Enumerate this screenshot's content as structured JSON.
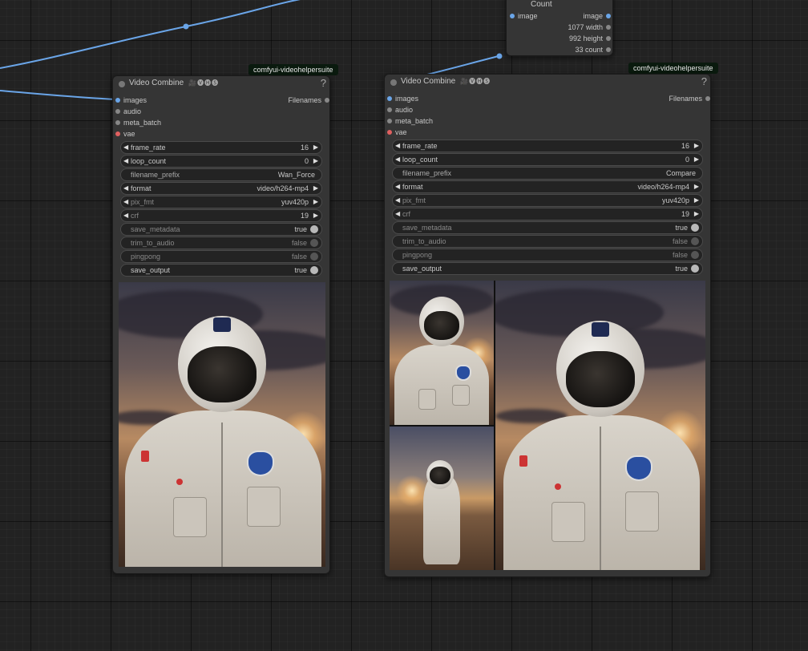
{
  "top_node": {
    "title": "Get Image Size & Count",
    "input_label": "image",
    "outputs": [
      {
        "label": "image"
      },
      {
        "label": "1077 width"
      },
      {
        "label": "992 height"
      },
      {
        "label": "33 count"
      }
    ]
  },
  "node1": {
    "badge": "comfyui-videohelpersuite",
    "title": "Video Combine",
    "title_icons": "🎥🅥🅗🅢",
    "help": "?",
    "inputs": [
      "images",
      "audio",
      "meta_batch",
      "vae"
    ],
    "output": "Filenames",
    "widgets": {
      "frame_rate": {
        "label": "frame_rate",
        "value": "16"
      },
      "loop_count": {
        "label": "loop_count",
        "value": "0"
      },
      "filename_prefix": {
        "label": "filename_prefix",
        "value": "Wan_Force"
      },
      "format": {
        "label": "format",
        "value": "video/h264-mp4"
      },
      "pix_fmt": {
        "label": "pix_fmt",
        "value": "yuv420p"
      },
      "crf": {
        "label": "crf",
        "value": "19"
      },
      "save_metadata": {
        "label": "save_metadata",
        "value": "true"
      },
      "trim_to_audio": {
        "label": "trim_to_audio",
        "value": "false"
      },
      "pingpong": {
        "label": "pingpong",
        "value": "false"
      },
      "save_output": {
        "label": "save_output",
        "value": "true"
      }
    }
  },
  "node2": {
    "badge": "comfyui-videohelpersuite",
    "title": "Video Combine",
    "title_icons": "🎥🅥🅗🅢",
    "help": "?",
    "inputs": [
      "images",
      "audio",
      "meta_batch",
      "vae"
    ],
    "output": "Filenames",
    "widgets": {
      "frame_rate": {
        "label": "frame_rate",
        "value": "16"
      },
      "loop_count": {
        "label": "loop_count",
        "value": "0"
      },
      "filename_prefix": {
        "label": "filename_prefix",
        "value": "Compare"
      },
      "format": {
        "label": "format",
        "value": "video/h264-mp4"
      },
      "pix_fmt": {
        "label": "pix_fmt",
        "value": "yuv420p"
      },
      "crf": {
        "label": "crf",
        "value": "19"
      },
      "save_metadata": {
        "label": "save_metadata",
        "value": "true"
      },
      "trim_to_audio": {
        "label": "trim_to_audio",
        "value": "false"
      },
      "pingpong": {
        "label": "pingpong",
        "value": "false"
      },
      "save_output": {
        "label": "save_output",
        "value": "true"
      }
    }
  },
  "colors": {
    "canvas": "#222222",
    "node_bg": "#353535",
    "link_blue": "#6aa5e8",
    "badge_bg": "#0a1a0e",
    "vae_dot": "#e06060"
  }
}
